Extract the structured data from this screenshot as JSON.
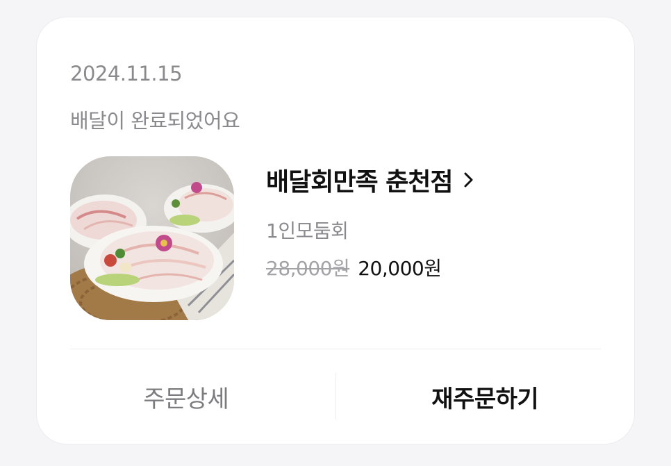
{
  "order": {
    "date": "2024.11.15",
    "status": "배달이 완료되었어요",
    "store_name": "배달회만족 춘천점",
    "menu_name": "1인모둠회",
    "original_price": "28,000원",
    "sale_price": "20,000원",
    "thumbnail_icon": "sashimi-platter-image"
  },
  "actions": {
    "detail_label": "주문상세",
    "reorder_label": "재주문하기"
  },
  "colors": {
    "background": "#f5f5f8",
    "card": "#ffffff",
    "muted_text": "#8a8a8e",
    "primary_text": "#111111"
  }
}
